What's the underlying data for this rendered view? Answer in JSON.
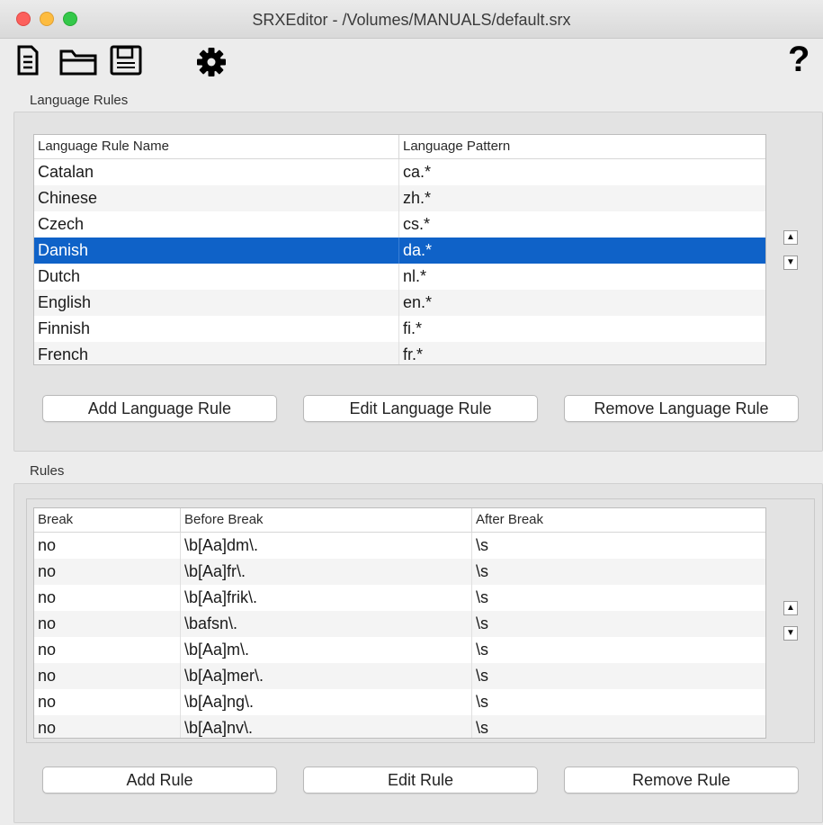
{
  "window": {
    "title": "SRXEditor - /Volumes/MANUALS/default.srx"
  },
  "toolbar": {
    "icons": [
      "new-document-icon",
      "open-folder-icon",
      "save-icon",
      "settings-gear-icon"
    ],
    "help": "?"
  },
  "language_rules": {
    "section_label": "Language Rules",
    "columns": [
      "Language Rule Name",
      "Language Pattern"
    ],
    "rows": [
      [
        "Catalan",
        "ca.*"
      ],
      [
        "Chinese",
        "zh.*"
      ],
      [
        "Czech",
        "cs.*"
      ],
      [
        "Danish",
        "da.*"
      ],
      [
        "Dutch",
        "nl.*"
      ],
      [
        "English",
        "en.*"
      ],
      [
        "Finnish",
        "fi.*"
      ],
      [
        "French",
        "fr.*"
      ]
    ],
    "selected_index": 3,
    "add_label": "Add Language Rule",
    "edit_label": "Edit Language Rule",
    "remove_label": "Remove Language Rule",
    "up_arrow": "▲",
    "down_arrow": "▼"
  },
  "rules": {
    "section_label": "Rules",
    "columns": [
      "Break",
      "Before Break",
      "After Break"
    ],
    "rows": [
      [
        "no",
        "\\b[Aa]dm\\.",
        "\\s"
      ],
      [
        "no",
        "\\b[Aa]fr\\.",
        "\\s"
      ],
      [
        "no",
        "\\b[Aa]frik\\.",
        "\\s"
      ],
      [
        "no",
        "\\bafsn\\.",
        "\\s"
      ],
      [
        "no",
        "\\b[Aa]m\\.",
        "\\s"
      ],
      [
        "no",
        "\\b[Aa]mer\\.",
        "\\s"
      ],
      [
        "no",
        "\\b[Aa]ng\\.",
        "\\s"
      ],
      [
        "no",
        "\\b[Aa]nv\\.",
        "\\s"
      ]
    ],
    "add_label": "Add Rule",
    "edit_label": "Edit Rule",
    "remove_label": "Remove Rule",
    "up_arrow": "▲",
    "down_arrow": "▼"
  }
}
